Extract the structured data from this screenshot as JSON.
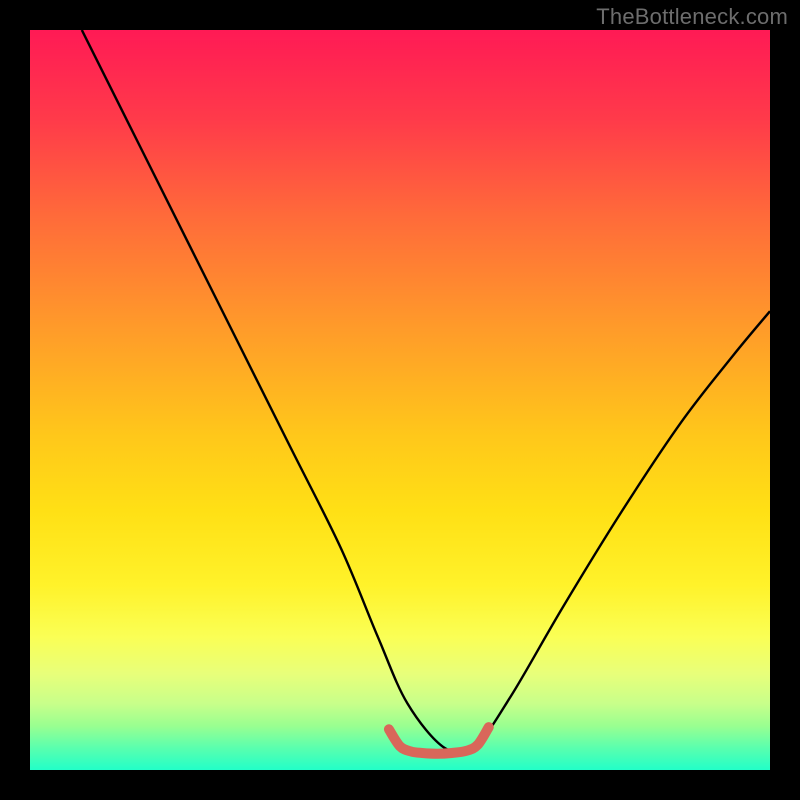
{
  "watermark": "TheBottleneck.com",
  "chart_data": {
    "type": "line",
    "title": "",
    "xlabel": "",
    "ylabel": "",
    "xlim": [
      0,
      100
    ],
    "ylim": [
      0,
      100
    ],
    "series": [
      {
        "name": "curve-black",
        "color": "#000000",
        "x": [
          7,
          15,
          25,
          35,
          42,
          47,
          51,
          56,
          60,
          65,
          72,
          80,
          88,
          95,
          100
        ],
        "y": [
          100,
          84,
          64,
          44,
          30,
          18,
          9,
          3,
          3,
          10,
          22,
          35,
          47,
          56,
          62
        ]
      },
      {
        "name": "flat-bottom-red",
        "color": "#d9675a",
        "x": [
          48.5,
          50,
          51.5,
          53,
          55,
          57,
          59,
          60.5,
          62
        ],
        "y": [
          5.5,
          3.2,
          2.5,
          2.3,
          2.2,
          2.3,
          2.6,
          3.4,
          5.8
        ]
      }
    ],
    "annotations": []
  }
}
